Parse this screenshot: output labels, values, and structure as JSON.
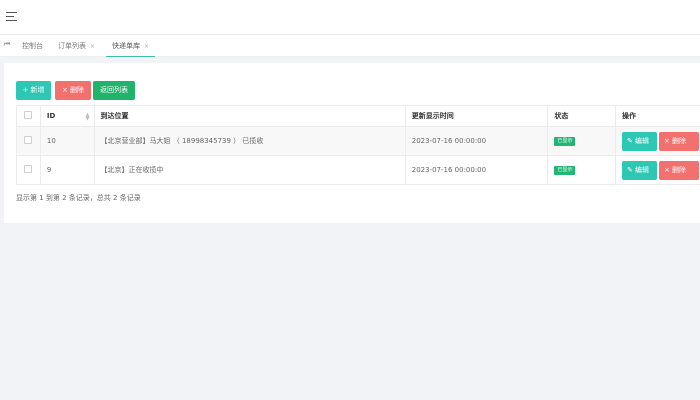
{
  "header": {
    "menu_icon": "hamburger-icon"
  },
  "tabs": [
    {
      "label": "控制台",
      "closable": false,
      "active": false
    },
    {
      "label": "订单列表",
      "closable": true,
      "active": false
    },
    {
      "label": "快递单库",
      "closable": true,
      "active": true
    }
  ],
  "tab_nav_icon": "double-chevron-left-icon",
  "close_glyph": "×",
  "toolbar": {
    "add_label": "+ 新增",
    "delete_label": "× 删除",
    "back_label": "返回列表"
  },
  "table": {
    "columns": [
      "",
      "ID",
      "到达位置",
      "更新显示时间",
      "状态",
      "操作"
    ],
    "rows": [
      {
        "id": "10",
        "location": "【北京营业部】马大姐 （ 18998345739 ） 已揽收",
        "time": "2023-07-16 00:00:00",
        "status": "已显示"
      },
      {
        "id": "9",
        "location": "【北京】正在收揽中",
        "time": "2023-07-16 00:00:00",
        "status": "已显示"
      }
    ],
    "edit_label": "✎ 编辑",
    "row_delete_label": "× 删除"
  },
  "footer": {
    "summary": "显示第 1 到第 2 条记录，总共 2 条记录"
  },
  "colors": {
    "accent": "#2ec7b4",
    "danger": "#f2706e",
    "success": "#1fb36b",
    "badge": "#22b573"
  }
}
